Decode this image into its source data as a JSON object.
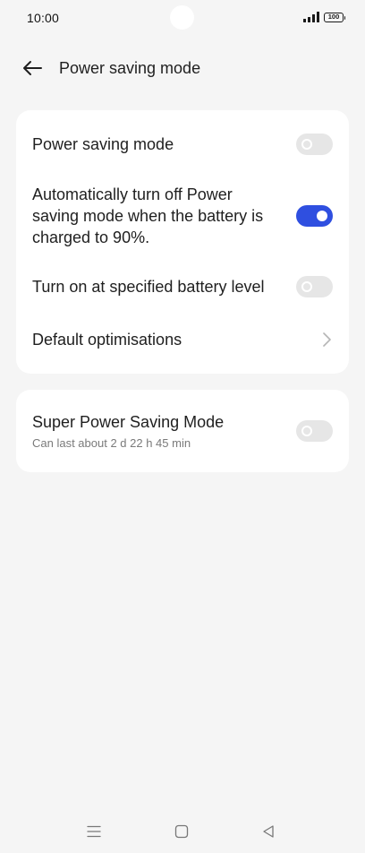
{
  "status_bar": {
    "time": "10:00",
    "battery_level": "100",
    "signal_icon": "signal-bars-icon",
    "battery_icon": "battery-icon"
  },
  "header": {
    "back_icon": "arrow-left-icon",
    "title": "Power saving mode"
  },
  "card_main": {
    "items": [
      {
        "label": "Power saving mode",
        "control": "toggle",
        "state": "off"
      },
      {
        "label": "Automatically turn off Power saving mode when the battery is charged to 90%.",
        "control": "toggle",
        "state": "on"
      },
      {
        "label": "Turn on at specified battery level",
        "control": "toggle",
        "state": "off"
      },
      {
        "label": "Default optimisations",
        "control": "chevron"
      }
    ]
  },
  "card_super": {
    "label": "Super Power Saving Mode",
    "subtitle": "Can last about 2 d 22 h 45 min",
    "control": "toggle",
    "state": "off"
  },
  "nav_bar": {
    "menu_icon": "menu-icon",
    "home_icon": "square-home-icon",
    "back_icon": "triangle-back-icon"
  },
  "colors": {
    "background": "#f5f5f5",
    "card": "#ffffff",
    "toggle_on": "#2f4fe0",
    "toggle_off": "#e6e6e6",
    "subtitle": "#7a7a7a"
  }
}
